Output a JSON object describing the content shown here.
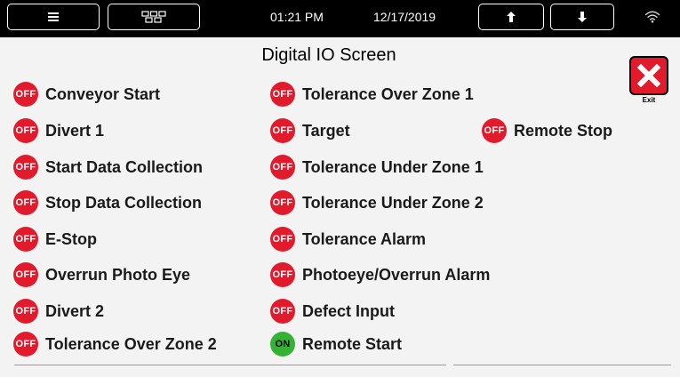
{
  "topbar": {
    "menu_icon": "hamburger-icon",
    "grid_icon": "grid-icon",
    "time": "01:21 PM",
    "date": "12/17/2019",
    "up_icon": "arrow-up-icon",
    "down_icon": "arrow-down-icon",
    "wifi_icon": "wifi-icon"
  },
  "screen_title": "Digital IO Screen",
  "exit": {
    "label": "Exit",
    "icon": "close-x-icon"
  },
  "colors": {
    "off": "#e21b2c",
    "on": "#34b233",
    "topbar": "#000000",
    "background": "#f3f3f3"
  },
  "io": [
    {
      "label": "Conveyor Start",
      "state": "OFF"
    },
    {
      "label": "Divert 1",
      "state": "OFF"
    },
    {
      "label": "Start Data Collection",
      "state": "OFF"
    },
    {
      "label": "Stop Data Collection",
      "state": "OFF"
    },
    {
      "label": "E-Stop",
      "state": "OFF"
    },
    {
      "label": "Overrun Photo Eye",
      "state": "OFF"
    },
    {
      "label": "Divert 2",
      "state": "OFF"
    },
    {
      "label": "Tolerance Over Zone 2",
      "state": "OFF"
    },
    {
      "label": "Tolerance Over Zone 1",
      "state": "OFF"
    },
    {
      "label": "Target",
      "state": "OFF"
    },
    {
      "label": "Tolerance Under Zone 1",
      "state": "OFF"
    },
    {
      "label": "Tolerance Under Zone 2",
      "state": "OFF"
    },
    {
      "label": "Tolerance Alarm",
      "state": "OFF"
    },
    {
      "label": "Photoeye/Overrun Alarm",
      "state": "OFF"
    },
    {
      "label": "Defect Input",
      "state": "OFF"
    },
    {
      "label": "Remote Start",
      "state": "ON"
    },
    {
      "label": "Remote Stop",
      "state": "OFF"
    }
  ]
}
